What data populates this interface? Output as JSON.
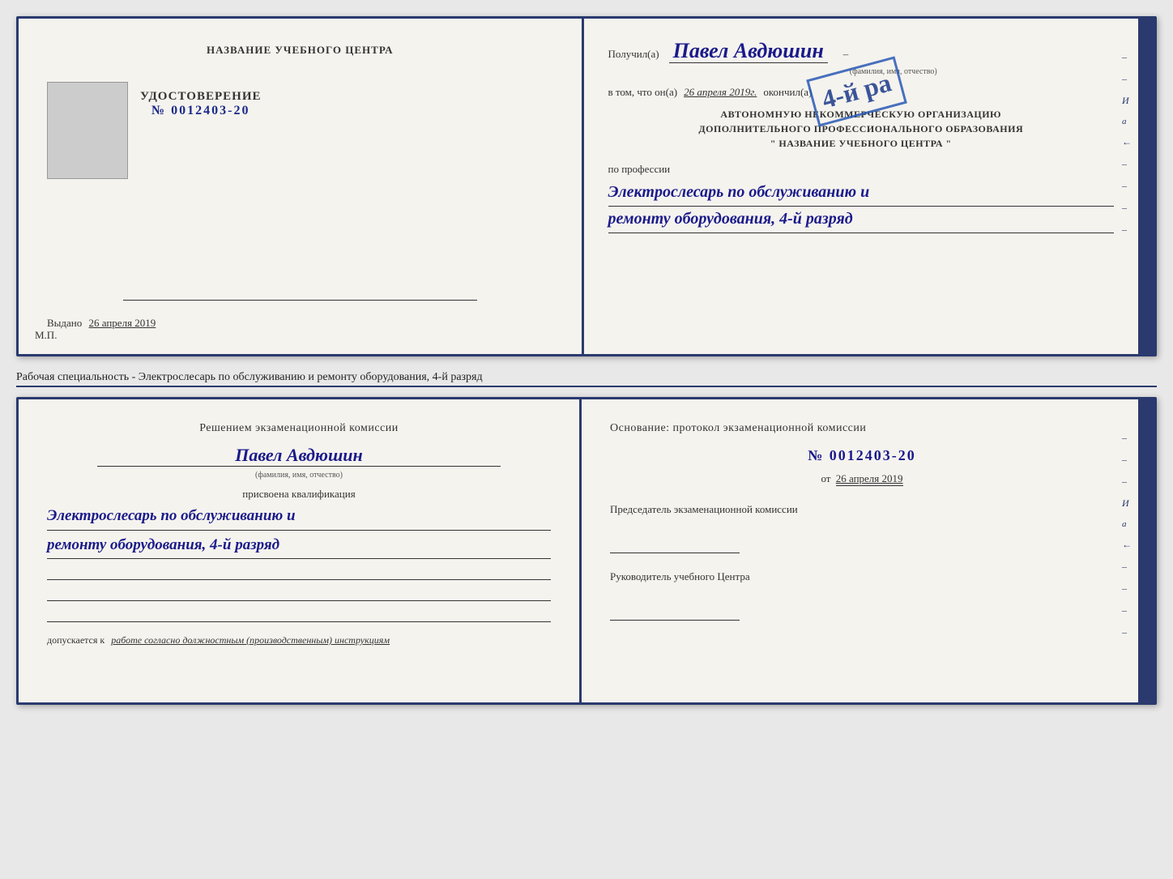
{
  "colors": {
    "dark_blue": "#2a3a6e",
    "handwriting_blue": "#1a1a8a",
    "text_dark": "#333333",
    "bg_paper": "#f5f3ee",
    "stamp_blue": "#2a5ab5"
  },
  "top_booklet": {
    "left": {
      "org_name": "НАЗВАНИЕ УЧЕБНОГО ЦЕНТРА",
      "cert_label": "УДОСТОВЕРЕНИЕ",
      "cert_number": "№ 0012403-20",
      "issued_label": "Выдано",
      "issued_date": "26 апреля 2019",
      "mp_label": "М.П."
    },
    "right": {
      "received_label": "Получил(а)",
      "recipient_name": "Павел Авдюшин",
      "name_subtitle": "(фамилия, имя, отчество)",
      "in_that_label": "в том, что он(а)",
      "completion_date": "26 апреля 2019г.",
      "completed_label": "окончил(а)",
      "stamp_number": "4-й ра",
      "org_line1": "АВТОНОМНУЮ НЕКОММЕРЧЕСКУЮ ОРГАНИЗАЦИЮ",
      "org_line2": "ДОПОЛНИТЕЛЬНОГО ПРОФЕССИОНАЛЬНОГО ОБРАЗОВАНИЯ",
      "org_line3": "\" НАЗВАНИЕ УЧЕБНОГО ЦЕНТРА \"",
      "profession_label": "по профессии",
      "profession_line1": "Электрослесарь по обслуживанию и",
      "profession_line2": "ремонту оборудования, 4-й разряд"
    }
  },
  "middle_caption": "Рабочая специальность - Электрослесарь по обслуживанию и ремонту оборудования, 4-й разряд",
  "bottom_booklet": {
    "left": {
      "commission_title": "Решением экзаменационной комиссии",
      "person_name": "Павел Авдюшин",
      "name_subtitle": "(фамилия, имя, отчество)",
      "qualification_label": "присвоена квалификация",
      "qualification_line1": "Электрослесарь по обслуживанию и",
      "qualification_line2": "ремонту оборудования, 4-й разряд",
      "допускается_label": "допускается к",
      "допускается_value": "работе согласно должностным (производственным) инструкциям"
    },
    "right": {
      "basis_title": "Основание: протокол экзаменационной комиссии",
      "protocol_number": "№  0012403-20",
      "date_label": "от",
      "date_value": "26 апреля 2019",
      "chairman_label": "Председатель экзаменационной комиссии",
      "director_label": "Руководитель учебного Центра",
      "right_labels": [
        "И",
        "а",
        "←",
        "–",
        "–",
        "–",
        "–"
      ]
    }
  }
}
